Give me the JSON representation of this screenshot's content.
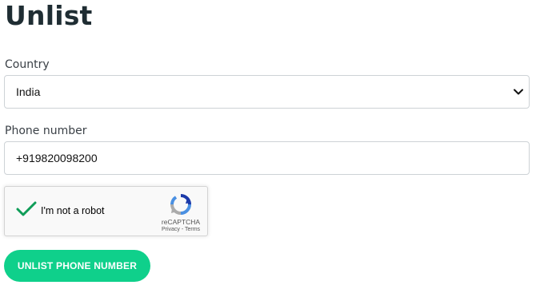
{
  "page": {
    "title": "Unlist"
  },
  "form": {
    "country_label": "Country",
    "country_value": "India",
    "phone_label": "Phone number",
    "phone_value": "+919820098200",
    "submit_label": "UNLIST PHONE NUMBER"
  },
  "recaptcha": {
    "label": "I'm not a robot",
    "brand": "reCAPTCHA",
    "terms": "Privacy - Terms",
    "checked": true
  },
  "colors": {
    "accent": "#0fd08b",
    "check": "#0f9d58",
    "title": "#1f2d33"
  },
  "icons": {
    "select_arrow": "chevron-down-icon",
    "captcha_check": "checkmark-icon",
    "captcha_logo": "recaptcha-logo-icon"
  }
}
